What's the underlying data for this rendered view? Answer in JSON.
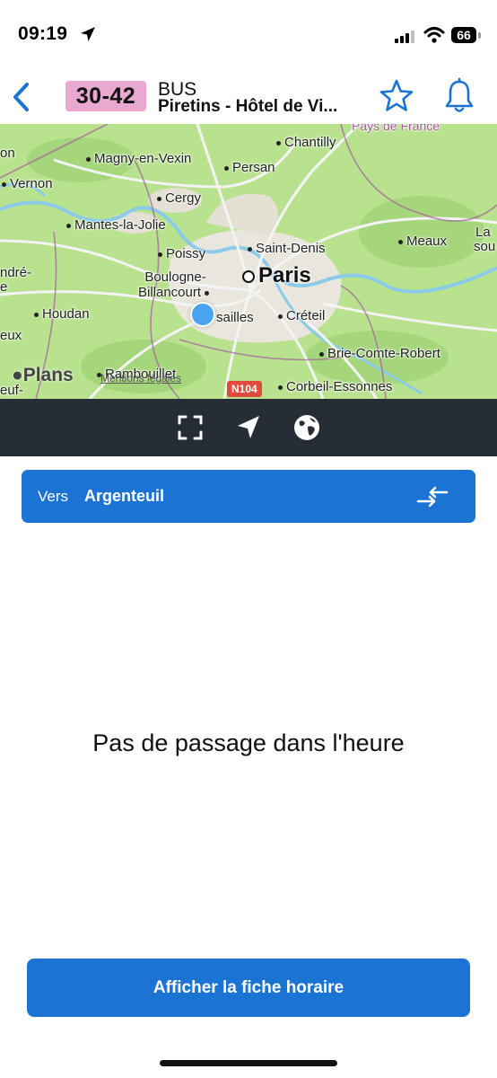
{
  "status_bar": {
    "time": "09:19",
    "battery": "66",
    "icons": [
      "location-arrow-icon",
      "signal-icon",
      "wifi-icon",
      "battery-icon"
    ]
  },
  "header": {
    "line_number": "30-42",
    "line_color": "#e9a8cf",
    "mode": "BUS",
    "route": "Piretins - Hôtel de Vi...",
    "icons": [
      "chevron-left-icon",
      "star-icon",
      "bell-icon"
    ]
  },
  "map": {
    "cities": {
      "chantilly": "Chantilly",
      "magny": "Magny-en-Vexin",
      "persan": "Persan",
      "vernon": "Vernon",
      "cergy": "Cergy",
      "mantes": "Mantes-la-Jolie",
      "poissy": "Poissy",
      "saint_denis": "Saint-Denis",
      "meaux": "Meaux",
      "paris": "Paris",
      "boulogne1": "Boulogne-",
      "boulogne2": "Billancourt",
      "versailles": "sailles",
      "creteil": "Créteil",
      "houdan": "Houdan",
      "brie": "Brie-Comte-Robert",
      "rambouillet": "Rambouillet",
      "corbeil": "Corbeil-Essonnes",
      "edge_dreux1": "ndré-",
      "edge_dreux2": "e",
      "edge_eux": "eux",
      "edge_euf": "euf-",
      "edge_on": "on",
      "edge_la": "La",
      "edge_sou": "sou",
      "pays_de_france": "Pays de France"
    },
    "attribution": "Plans",
    "legal": "Mentions légales",
    "road_badge": "N104",
    "colors": {
      "land": "#b9e28f",
      "urban": "#e9e6dd",
      "road": "#f2f2f2",
      "water": "#8ccbe8",
      "border": "#a65aa0",
      "user_dot": "#4aa3f0"
    }
  },
  "map_controls": {
    "icons": [
      "fullscreen-icon",
      "locate-icon",
      "globe-icon"
    ],
    "background": "#262d35"
  },
  "direction": {
    "prefix": "Vers",
    "destination": "Argenteuil",
    "accent": "#1b74d4",
    "icon": "swap-direction-icon"
  },
  "main": {
    "message": "Pas de passage dans l'heure"
  },
  "footer": {
    "timetable_button": "Afficher la fiche horaire"
  }
}
